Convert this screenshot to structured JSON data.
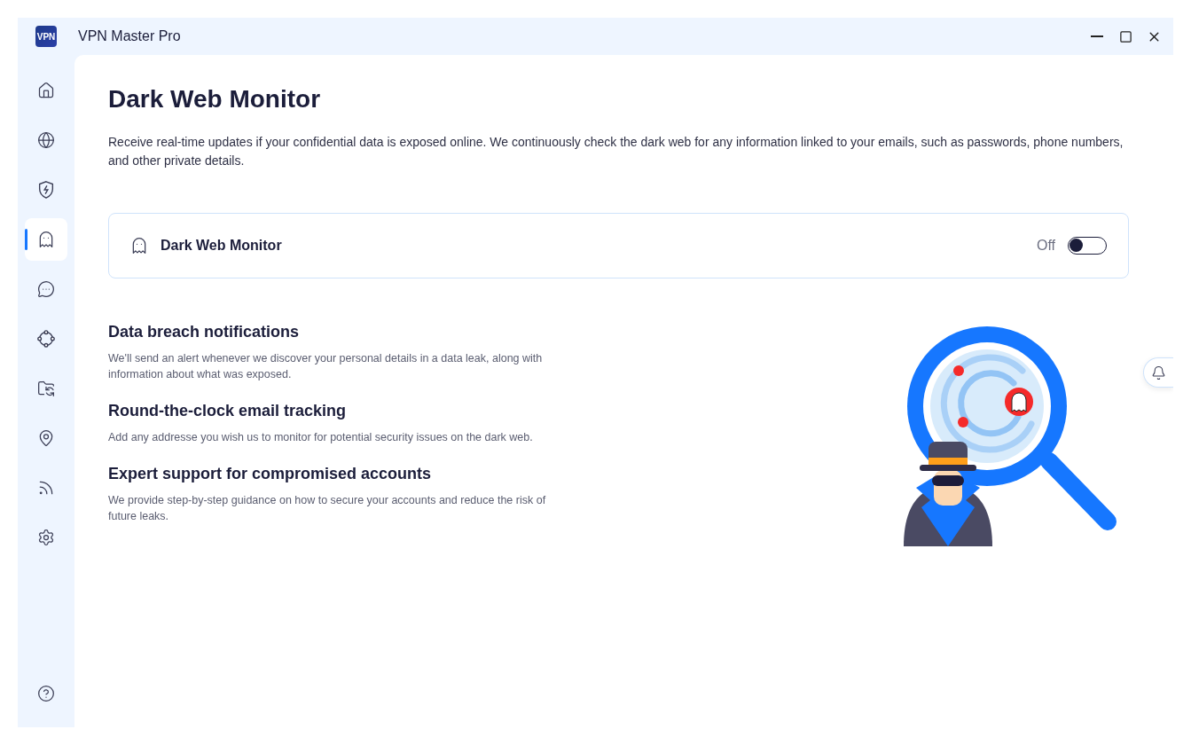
{
  "window": {
    "logo": "VPN",
    "title": "VPN Master Pro"
  },
  "sidebar": {
    "items": [
      {
        "selected": false
      },
      {
        "selected": false
      },
      {
        "selected": false
      },
      {
        "selected": true
      },
      {
        "selected": false
      },
      {
        "selected": false
      },
      {
        "selected": false
      },
      {
        "selected": false
      },
      {
        "selected": false
      },
      {
        "selected": false
      }
    ]
  },
  "page": {
    "title": "Dark Web Monitor",
    "description": "Receive real-time updates if your confidential data is exposed online. We continuously check the dark web for any information linked to your emails, such as passwords, phone numbers, and other private details."
  },
  "monitor_card": {
    "label": "Dark Web Monitor",
    "state_text": "Off",
    "on": false
  },
  "features": [
    {
      "title": "Data breach notifications",
      "text": "We'll send an alert whenever we discover your personal details in a data leak, along with information about what was exposed."
    },
    {
      "title": "Round-the-clock email tracking",
      "text": "Add any addresse you wish us to monitor for potential security issues on the dark web."
    },
    {
      "title": "Expert support for compromised accounts",
      "text": "We provide step-by-step guidance on how to secure your accounts and reduce the risk of future leaks."
    }
  ]
}
